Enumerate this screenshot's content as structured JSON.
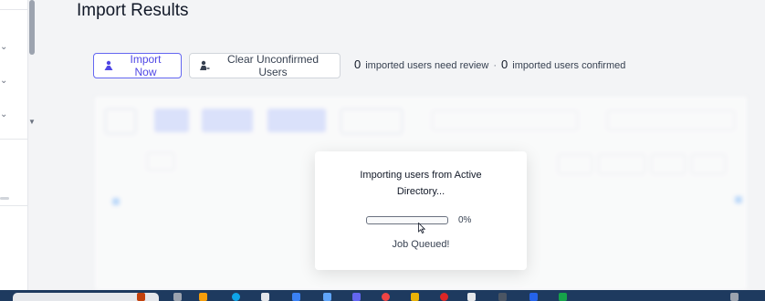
{
  "page": {
    "title": "Import Results"
  },
  "actions": {
    "import_now": "Import Now",
    "clear_unconfirmed": "Clear Unconfirmed Users"
  },
  "summary": {
    "review_count": "0",
    "review_label": "imported users need review",
    "separator": "·",
    "confirmed_count": "0",
    "confirmed_label": "imported users confirmed"
  },
  "modal": {
    "message": "Importing users from Active Directory...",
    "progress_percent": "0%",
    "progress_fraction": 0,
    "status": "Job Queued!"
  },
  "colors": {
    "accent": "#4f46e5",
    "taskbar": "#1e3a5f"
  }
}
